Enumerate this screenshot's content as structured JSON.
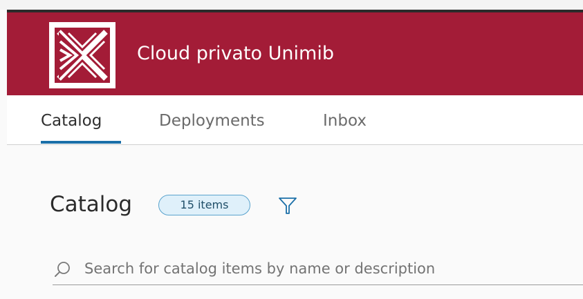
{
  "header": {
    "app_title": "Cloud privato Unimib",
    "logo_icon": "unimib-logo-icon",
    "background_color": "#a31c37"
  },
  "tabs": [
    {
      "label": "Catalog",
      "active": true
    },
    {
      "label": "Deployments",
      "active": false
    },
    {
      "label": "Inbox",
      "active": false
    }
  ],
  "main": {
    "title": "Catalog",
    "count_badge": "15 items",
    "filter_icon": "filter-icon",
    "search": {
      "placeholder": "Search for catalog items by name or description",
      "value": "",
      "icon": "search-icon"
    }
  },
  "colors": {
    "accent": "#1a6fa8",
    "badge_border": "#59a3cd",
    "badge_fill": "#dff0fa"
  }
}
